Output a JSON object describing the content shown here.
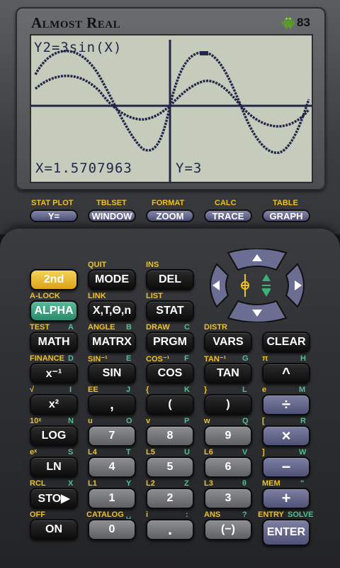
{
  "brand": "Almost Real",
  "battery": "83",
  "screen": {
    "equation": "Y2=3sin(X)",
    "x_readout": "X=1.5707963",
    "y_readout": "Y=3"
  },
  "fkeys": [
    {
      "top": "STAT PLOT",
      "label": "Y="
    },
    {
      "top": "TBLSET",
      "label": "WINDOW"
    },
    {
      "top": "FORMAT",
      "label": "ZOOM"
    },
    {
      "top": "CALC",
      "label": "TRACE"
    },
    {
      "top": "TABLE",
      "label": "GRAPH"
    }
  ],
  "keys": {
    "second": "2nd",
    "mode": "MODE",
    "del": "DEL",
    "alpha": "ALPHA",
    "xton": "X,T,Θ,n",
    "stat": "STAT",
    "math": "MATH",
    "matrx": "MATRX",
    "prgm": "PRGM",
    "vars": "VARS",
    "clear": "CLEAR",
    "inv": "x⁻¹",
    "sin": "SIN",
    "cos": "COS",
    "tan": "TAN",
    "pow": "^",
    "sq": "x²",
    "comma": ",",
    "lparen": "(",
    "rparen": ")",
    "div": "÷",
    "log": "LOG",
    "n7": "7",
    "n8": "8",
    "n9": "9",
    "mul": "×",
    "ln": "LN",
    "n4": "4",
    "n5": "5",
    "n6": "6",
    "sub": "−",
    "sto": "STO▶",
    "n1": "1",
    "n2": "2",
    "n3": "3",
    "add": "+",
    "on": "ON",
    "n0": "0",
    "dot": ".",
    "neg": "(−)",
    "enter": "ENTER"
  },
  "labels": {
    "quit": "QUIT",
    "ins": "INS",
    "alock": "A-LOCK",
    "link": "LINK",
    "list": "LIST",
    "test": "TEST",
    "test_a": "A",
    "angle": "ANGLE",
    "angle_b": "B",
    "draw": "DRAW",
    "draw_c": "C",
    "distr": "DISTR",
    "finance": "FINANCE",
    "finance_d": "D",
    "asin": "SIN⁻¹",
    "asin_e": "E",
    "acos": "COS⁻¹",
    "acos_f": "F",
    "atan": "TAN⁻¹",
    "atan_g": "G",
    "pi": "π",
    "pi_h": "H",
    "sqrt": "√",
    "sqrt_i": "I",
    "ee": "EE",
    "ee_j": "J",
    "lbrace": "{",
    "lbrace_k": "K",
    "rbrace": "}",
    "rbrace_l": "L",
    "e": "e",
    "e_m": "M",
    "tenx": "10ˣ",
    "tenx_n": "N",
    "u": "u",
    "u_o": "O",
    "v": "v",
    "v_p": "P",
    "w": "w",
    "w_q": "Q",
    "lbrack": "[",
    "lbrack_r": "R",
    "ex": "eˣ",
    "ex_s": "S",
    "l4": "L4",
    "l4_t": "T",
    "l5": "L5",
    "l5_u": "U",
    "l6": "L6",
    "l6_v": "V",
    "rbrack": "]",
    "rbrack_w": "W",
    "rcl": "RCL",
    "rcl_x": "X",
    "l1": "L1",
    "l1_y": "Y",
    "l2": "L2",
    "l2_z": "Z",
    "l3": "L3",
    "l3_t": "θ",
    "mem": "MEM",
    "mem_q": "\"",
    "off": "OFF",
    "catalog": "CATALOG",
    "catalog_s": "␣",
    "i": "i",
    "i_c": ":",
    "ans": "ANS",
    "ans_q": "?",
    "entry": "ENTRY",
    "solve": "SOLVE"
  },
  "colors": {
    "lcd": "#c5ccbb",
    "pixel": "#23264a",
    "second_key": "#e8b72f",
    "alpha_key": "#3ea07e",
    "fn_label": "#f0c020"
  }
}
